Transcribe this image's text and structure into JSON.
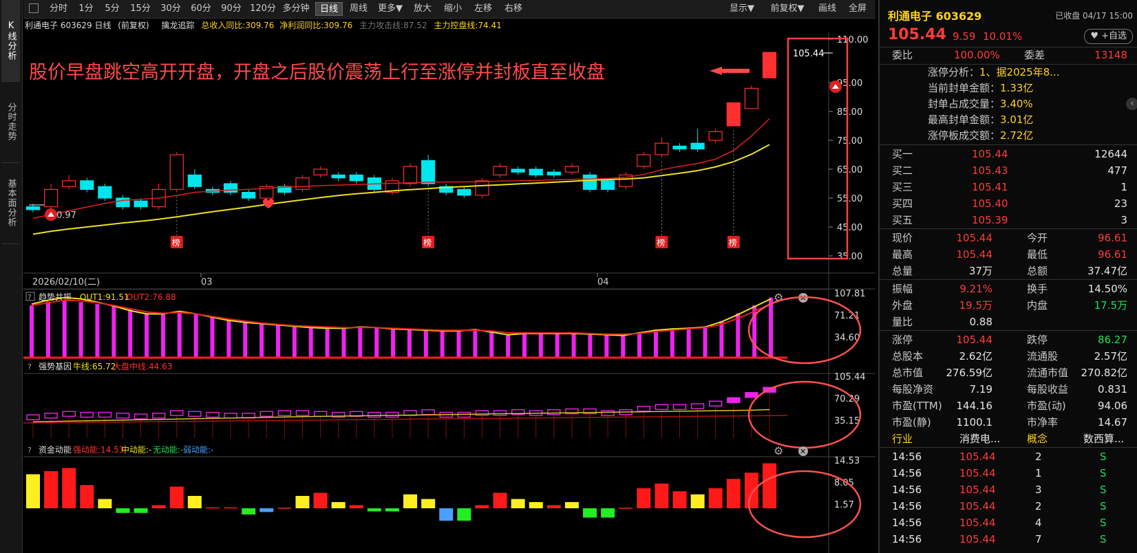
{
  "side_tabs": [
    "K线分析",
    "分时走势",
    "基本面分析"
  ],
  "toolbar_left": [
    "分时",
    "1分",
    "5分",
    "15分",
    "30分",
    "60分",
    "90分",
    "120分",
    "多分钟",
    "日线",
    "周线",
    "更多▼",
    "放大",
    "缩小",
    "左移",
    "右移"
  ],
  "toolbar_active": "日线",
  "toolbar_right": [
    "显示▼",
    "前复权▼",
    "画线",
    "全屏"
  ],
  "info": {
    "stock": "利通电子 603629 日线",
    "adjust": "(前复权)",
    "indicator": "擒龙追踪",
    "revenue": "总收入同比:309.76",
    "profit": "净利润同比:309.76",
    "attack": "主力攻击线:87.52",
    "control": "主力控盘线:74.41"
  },
  "annotation": "股价早盘跳空高开开盘，开盘之后股价震荡上行至涨停并封板直至收盘",
  "price_label": "105.44",
  "low_label": "0.97",
  "bang_label": "榜",
  "date_axis": {
    "first": "2026/02/10(二)",
    "march": "03",
    "april": "04"
  },
  "panels": {
    "p1": {
      "name": "趋势共振",
      "out1": "OUT1:91.51",
      "out2": "OUT2:76.88",
      "ticks": [
        "107.81",
        "71.21",
        "34.60"
      ]
    },
    "p2": {
      "name": "强势基因",
      "bull": "牛线:65.72",
      "mid": "大盘中线:44.63",
      "ticks": [
        "105.44",
        "70.29",
        "35.15"
      ]
    },
    "p3": {
      "name": "资金动能",
      "strong": "强动能:14.53",
      "medium": "中动能:-",
      "none": "无动能:-",
      "weak": "弱动能:-",
      "ticks": [
        "14.53",
        "8.05",
        "1.57"
      ]
    },
    "help_icon": "?"
  },
  "chart_data": {
    "type": "candlestick",
    "ylim": [
      35,
      110
    ],
    "yticks": [
      "110.00",
      "95.00",
      "85.00",
      "75.00",
      "65.00",
      "55.00",
      "45.00",
      "35.00"
    ],
    "candles": [
      [
        52,
        51,
        53,
        50
      ],
      [
        52,
        58,
        60,
        51
      ],
      [
        59,
        61,
        63,
        58
      ],
      [
        61,
        58,
        62,
        57
      ],
      [
        59,
        55,
        60,
        54
      ],
      [
        55,
        52,
        56,
        51
      ],
      [
        54,
        52,
        55,
        51
      ],
      [
        52,
        58,
        60,
        51
      ],
      [
        58,
        70,
        71,
        57
      ],
      [
        63,
        59,
        65,
        58
      ],
      [
        58,
        57,
        59,
        56
      ],
      [
        60,
        57,
        61,
        56
      ],
      [
        57,
        55,
        58,
        54
      ],
      [
        55,
        59,
        60,
        54
      ],
      [
        59,
        57,
        60,
        56
      ],
      [
        58,
        62,
        63,
        57
      ],
      [
        63,
        65,
        66,
        62
      ],
      [
        63,
        62,
        64,
        61
      ],
      [
        63,
        61,
        64,
        60
      ],
      [
        62,
        58,
        63,
        57
      ],
      [
        57,
        61,
        62,
        56
      ],
      [
        60,
        66,
        67,
        59
      ],
      [
        68,
        60,
        70,
        59
      ],
      [
        59,
        57,
        60,
        56
      ],
      [
        58,
        56,
        59,
        55
      ],
      [
        56,
        61,
        62,
        55
      ],
      [
        63,
        66,
        67,
        62
      ],
      [
        65,
        64,
        66,
        63
      ],
      [
        65,
        63,
        66,
        62
      ],
      [
        64,
        63,
        65,
        62
      ],
      [
        64,
        66,
        67,
        63
      ],
      [
        63,
        58,
        64,
        57
      ],
      [
        61,
        58,
        62,
        57
      ],
      [
        59,
        63,
        64,
        58
      ],
      [
        66,
        70,
        71,
        65
      ],
      [
        70,
        74,
        76,
        69
      ],
      [
        73,
        72,
        74,
        71
      ],
      [
        74,
        72,
        79,
        71
      ],
      [
        75,
        78,
        79,
        74
      ],
      [
        80,
        88,
        88,
        80
      ],
      [
        86,
        93,
        94,
        86
      ],
      [
        96.61,
        105.44,
        105.44,
        96.61
      ]
    ],
    "ma_red": [
      48,
      49.3,
      50.6,
      51.9,
      53.2,
      54.2,
      54.6,
      55,
      55.9,
      57,
      57.4,
      57.8,
      58,
      58.4,
      58.8,
      59,
      59.3,
      59.5,
      59.7,
      59.9,
      60.1,
      60.3,
      60.5,
      60.6,
      60.6,
      60.7,
      60.9,
      61,
      61.1,
      61.3,
      61.5,
      61.6,
      61.8,
      62.2,
      63.2,
      64.8,
      66,
      67,
      68.5,
      71.5,
      76.5,
      82.5
    ],
    "ma_yellow": [
      42.5,
      43.5,
      44.3,
      45,
      45.7,
      46.4,
      47,
      47.7,
      48.5,
      49.4,
      50.3,
      51.1,
      51.9,
      52.8,
      53.6,
      54.4,
      55.2,
      55.9,
      56.5,
      57,
      57.5,
      57.9,
      58.3,
      58.7,
      59,
      59.3,
      59.6,
      59.9,
      60.2,
      60.5,
      60.8,
      61.2,
      61.4,
      61.6,
      62,
      62.8,
      63.6,
      64.5,
      65.8,
      67.6,
      70.2,
      73.5
    ],
    "bang_at": [
      8,
      22,
      35,
      39
    ],
    "p1_bars": [
      80,
      86,
      88,
      85,
      82,
      79,
      74,
      68,
      68,
      71,
      66,
      62,
      58,
      55,
      53,
      51,
      49,
      47,
      46,
      46,
      47,
      46,
      45,
      44,
      43,
      42,
      41,
      42,
      40,
      36,
      38,
      38,
      38,
      38,
      37,
      36,
      35,
      38,
      43,
      45,
      46,
      48,
      56,
      68,
      80,
      92
    ],
    "p1_yellow": [
      82,
      88,
      92,
      90,
      85,
      79,
      72,
      67,
      67,
      71,
      67,
      62,
      57,
      54,
      52,
      50,
      48,
      46,
      45,
      45,
      47,
      46,
      44,
      43,
      42,
      41,
      41,
      43,
      39,
      35,
      37,
      37,
      37,
      37,
      36,
      35,
      34,
      38,
      42,
      44,
      45,
      47,
      55,
      66,
      78,
      90
    ],
    "p1_red": [
      80,
      84,
      88,
      87,
      84,
      80,
      75,
      70,
      68,
      69,
      67,
      63,
      59,
      56,
      53,
      51,
      49,
      48,
      47,
      46,
      46,
      46,
      45,
      44,
      43,
      42,
      42,
      42,
      41,
      38,
      38,
      38,
      38,
      38,
      37,
      36,
      36,
      37,
      40,
      42,
      44,
      46,
      51,
      60,
      71,
      82
    ],
    "p2_bars": [
      62,
      64,
      66,
      65,
      65,
      64,
      63,
      64,
      67,
      66,
      65,
      64,
      64,
      66,
      67,
      67,
      66,
      65,
      66,
      65,
      65,
      67,
      68,
      65,
      65,
      67,
      67,
      68,
      67,
      68,
      69,
      69,
      67,
      68,
      72,
      74,
      74,
      75,
      78,
      82,
      88,
      94
    ],
    "p2_yellow": [
      54,
      54.4,
      54.8,
      55.2,
      55.6,
      56,
      56.4,
      56.8,
      57.2,
      57.6,
      58,
      58.4,
      58.8,
      59.2,
      59.6,
      60,
      60.3,
      60.6,
      60.9,
      61.2,
      61.5,
      61.8,
      62.1,
      62.4,
      62.7,
      63,
      63.3,
      63.6,
      63.9,
      64.2,
      64.5,
      64.8,
      65.1,
      65.4,
      65.7,
      66,
      66.3,
      66.6,
      66.9,
      67.2,
      67.5,
      68.2
    ],
    "p3_bars": [
      11,
      12,
      13,
      7.5,
      3,
      -1.5,
      -1.5,
      1,
      7,
      4,
      0.3,
      0.3,
      -2,
      -1.2,
      0.2,
      4,
      5,
      2,
      1,
      -1,
      -1,
      4.5,
      3,
      -4,
      -4,
      1,
      5,
      3,
      2,
      1,
      2,
      -3,
      -3,
      0.2,
      6.5,
      8,
      5.5,
      4.5,
      6.5,
      9.5,
      11.5,
      14.53
    ]
  }
}
